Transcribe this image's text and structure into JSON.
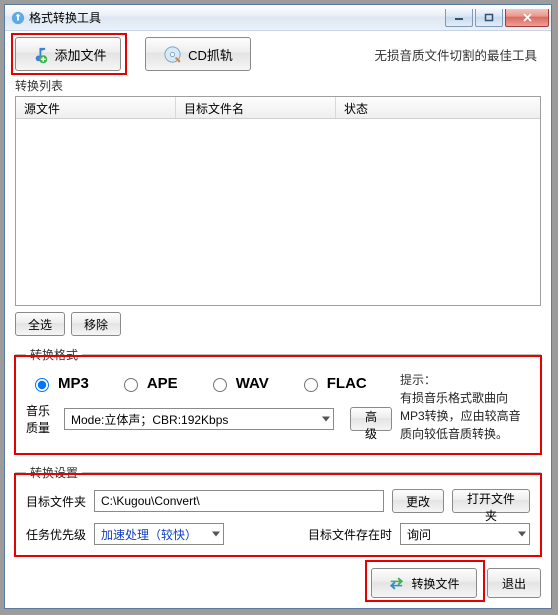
{
  "window": {
    "title": "格式转换工具"
  },
  "toolbar": {
    "add_file": "添加文件",
    "cd_rip": "CD抓轨",
    "slogan": "无损音质文件切割的最佳工具"
  },
  "convert_list": {
    "title": "转换列表",
    "col_source": "源文件",
    "col_target": "目标文件名",
    "col_status": "状态",
    "rows": []
  },
  "list_buttons": {
    "select_all": "全选",
    "remove": "移除"
  },
  "format": {
    "legend": "转换格式",
    "options": [
      "MP3",
      "APE",
      "WAV",
      "FLAC"
    ],
    "selected": "MP3",
    "hint_title": "提示：",
    "hint_body": "有损音乐格式歌曲向MP3转换，应由较高音质向较低音质转换。",
    "quality_label": "音乐质量",
    "quality_value": "Mode:立体声；CBR:192Kbps",
    "advanced": "高级"
  },
  "settings": {
    "legend": "转换设置",
    "target_folder_label": "目标文件夹",
    "target_folder_value": "C:\\Kugou\\Convert\\",
    "change_btn": "更改",
    "open_btn": "打开文件夹",
    "priority_label": "任务优先级",
    "priority_value": "加速处理（较快）",
    "exists_label": "目标文件存在时",
    "exists_value": "询问"
  },
  "footer": {
    "convert": "转换文件",
    "exit": "退出"
  }
}
